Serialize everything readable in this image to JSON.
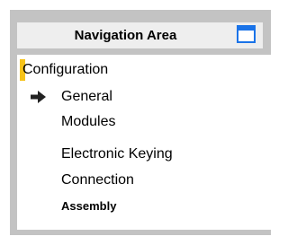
{
  "header": {
    "title": "Navigation Area",
    "icon": "window-icon",
    "icon_color": "#1a73e8"
  },
  "navigation": {
    "root": {
      "label": "Configuration",
      "marker_color": "#f6c31b"
    },
    "items": [
      {
        "label": "General",
        "selected": true,
        "icon": "arrow-right-icon"
      },
      {
        "label": "Modules"
      },
      {
        "label": "Electronic Keying"
      },
      {
        "label": "Connection"
      },
      {
        "label": "Assembly",
        "bold": true
      }
    ]
  }
}
